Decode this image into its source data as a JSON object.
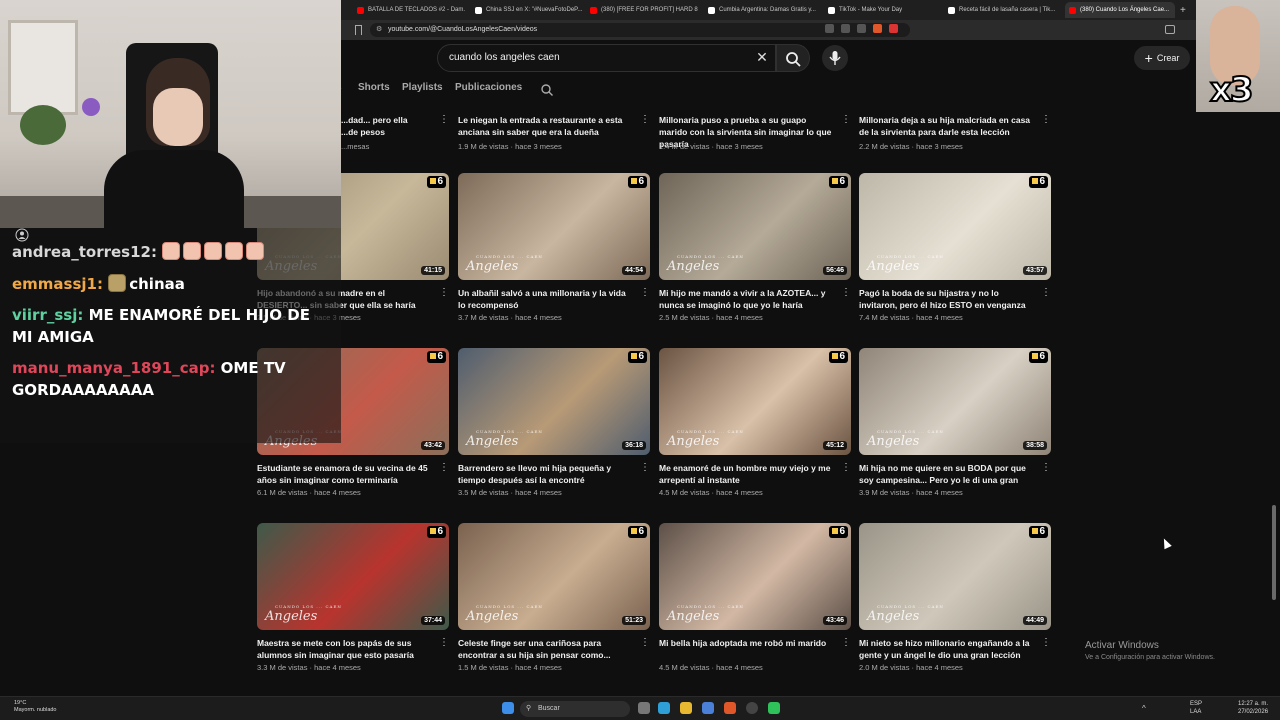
{
  "browser": {
    "tabs": [
      {
        "label": "BATALLA DE TECLADOS #2 - Dam...",
        "color": "#ff0000"
      },
      {
        "label": "China SSJ en X: \"#NuevaFotoDeP...",
        "color": "#ffffff"
      },
      {
        "label": "(380) [FREE FOR PROFIT] HARD 8...",
        "color": "#ff0000"
      },
      {
        "label": "Cumbia Argentina: Damas Gratis y...",
        "color": "#ffffff"
      },
      {
        "label": "TikTok - Make Your Day",
        "color": "#ffffff"
      },
      {
        "label": "Receta fácil de lasaña casera | Tik...",
        "color": "#ffffff"
      },
      {
        "label": "(380) Cuando Los Ángeles Cae...",
        "color": "#ff0000"
      }
    ],
    "close_tab": "×",
    "new_tab": "+",
    "url": "youtube.com/@CuandoLosAngelesCaen/videos"
  },
  "youtube": {
    "search_query": "cuando los angeles caen",
    "create_label": "Crear",
    "channel_tabs": [
      "s",
      "Shorts",
      "Playlists",
      "Publicaciones"
    ],
    "top_row": [
      {
        "title": "...dad... pero ella\n...de pesos",
        "meta": "...mesas"
      },
      {
        "title": "Le niegan la entrada a restaurante a esta anciana sin saber que era la dueña",
        "meta": "1.9 M de vistas · hace 3 meses"
      },
      {
        "title": "Millonaria puso a prueba a su guapo marido con la sirvienta sin imaginar lo que pasaría",
        "meta": "1.4 M de vistas · hace 3 meses"
      },
      {
        "title": "Millonaria deja a su hija malcriada en casa de la sirvienta para darle esta lección",
        "meta": "2.2 M de vistas · hace 3 meses"
      }
    ],
    "videos": [
      {
        "title": "Hijo abandonó a su madre en el DESIERTO... sin saber que ella se haría millonaria",
        "meta": "2.5 M de vistas · hace 3 meses",
        "duration": "41:15",
        "colors": [
          "#9a8b72",
          "#c7b89a"
        ]
      },
      {
        "title": "Un albañil salvó a una millonaria y la vida lo recompensó",
        "meta": "3.7 M de vistas · hace 4 meses",
        "duration": "44:54",
        "colors": [
          "#7d6a58",
          "#c9b6a0"
        ]
      },
      {
        "title": "Mi hijo me mandó a vivir a la AZOTEA... y nunca se imaginó lo que yo le haría",
        "meta": "2.5 M de vistas · hace 4 meses",
        "duration": "56:46",
        "colors": [
          "#6e6558",
          "#b5aa98"
        ]
      },
      {
        "title": "Pagó la boda de su hijastra y no lo invitaron, pero él hizo ESTO en venganza",
        "meta": "7.4 M de vistas · hace 4 meses",
        "duration": "43:57",
        "colors": [
          "#bdb7a8",
          "#e6e0d4"
        ]
      },
      {
        "title": "Estudiante se enamora de su vecina de 45 años sin imaginar como terminaría",
        "meta": "6.1 M de vistas · hace 4 meses",
        "duration": "43:42",
        "colors": [
          "#8a6f5a",
          "#c45a4a"
        ]
      },
      {
        "title": "Barrendero se llevo mi hija pequeña y tiempo después así la encontré",
        "meta": "3.5 M de vistas · hace 4 meses",
        "duration": "36:18",
        "colors": [
          "#4f5d6e",
          "#b89a76"
        ]
      },
      {
        "title": "Me enamoré de un hombre muy viejo y me arrepentí al instante",
        "meta": "4.5 M de vistas · hace 4 meses",
        "duration": "45:12",
        "colors": [
          "#6b5443",
          "#d9c0a8"
        ]
      },
      {
        "title": "Mi hija no me quiere en su BODA por que soy campesina... Pero yo le di una gran lección",
        "meta": "3.9 M de vistas · hace 4 meses",
        "duration": "38:58",
        "colors": [
          "#8f8578",
          "#d8d0c4"
        ]
      },
      {
        "title": "Maestra se mete con los papás de sus alumnos sin imaginar que esto pasaría",
        "meta": "3.3 M de vistas · hace 4 meses",
        "duration": "37:44",
        "colors": [
          "#3e5a4a",
          "#b8342e"
        ]
      },
      {
        "title": "Celeste finge ser una cariñosa para encontrar a su hija sin pensar como...",
        "meta": "1.5 M de vistas · hace 4 meses",
        "duration": "51:23",
        "colors": [
          "#7a6250",
          "#c8ad90"
        ]
      },
      {
        "title": "Mi bella hija adoptada me robó mi marido",
        "meta": "4.5 M de vistas · hace 4 meses",
        "duration": "43:46",
        "colors": [
          "#5d5048",
          "#d2b8a4"
        ]
      },
      {
        "title": "Mi nieto se hizo millonario engañando a la gente y un ángel le dio una gran lección",
        "meta": "2.0 M de vistas · hace 4 meses",
        "duration": "44:49",
        "colors": [
          "#9a9488",
          "#cfc8ba"
        ]
      }
    ],
    "watermark": "Angeles",
    "watermark_small": "CUANDO LOS ... CAEN",
    "badge": "6",
    "kebab": "⋮"
  },
  "stream": {
    "chat": [
      {
        "user": "andrea_torres12:",
        "user_color": "#d8d8d8",
        "message": "",
        "emotes": 5,
        "emote_kind": "face"
      },
      {
        "user": "emmassj1:",
        "user_color": "#f0a848",
        "message": "chinaa",
        "emotes": 1,
        "emote_kind": "cat"
      },
      {
        "user": "viirr_ssj:",
        "user_color": "#5fd0a0",
        "message": "ME ENAMORÉ DEL HIJO DE MI AMIGA",
        "emotes": 0,
        "emote_kind": ""
      },
      {
        "user": "manu_manya_1891_cap:",
        "user_color": "#e0465a",
        "message": "OME TV GORDAAAAAAAA",
        "emotes": 0,
        "emote_kind": ""
      }
    ],
    "cam_overlay_text": "x3"
  },
  "windows": {
    "activate_title": "Activar Windows",
    "activate_sub": "Ve a Configuración para activar Windows.",
    "weather_temp": "19°C",
    "weather_desc": "Mayorm. nublado",
    "search_label": "Buscar",
    "lang1": "ESP",
    "lang2": "LAA",
    "time": "12:27 a. m.",
    "date": "27/02/2026"
  },
  "colors": {
    "youtube_bg": "#0f0f0f",
    "accent_red": "#ff0000"
  }
}
